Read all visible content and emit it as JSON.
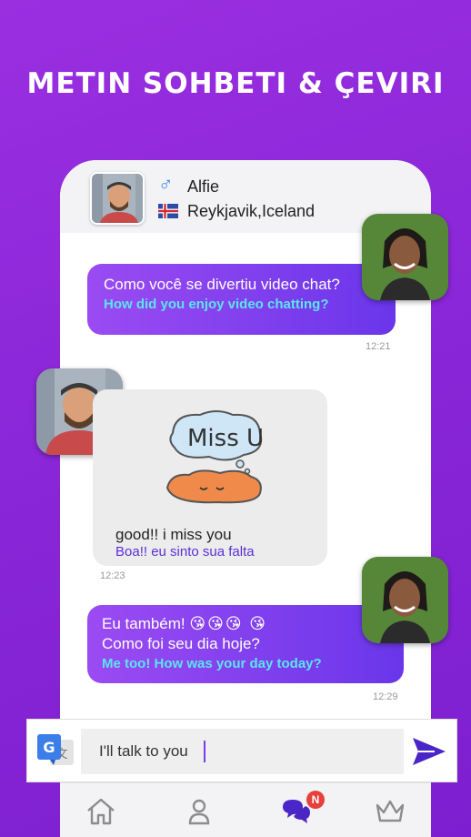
{
  "headline": "METIN SOHBETI & ÇEVIRI",
  "contact": {
    "gender_icon": "male-sign-icon",
    "name": "Alfie",
    "flag_icon": "iceland-flag-icon",
    "location": "Reykjavik,Iceland"
  },
  "messages": [
    {
      "direction": "outgoing",
      "original": "Como você se divertiu video chat?",
      "translation": "How did you enjoy video chatting?",
      "time": "12:21"
    },
    {
      "direction": "incoming",
      "sticker_text": "Miss U",
      "original": "good!! i miss you",
      "translation": "Boa!! eu sinto sua falta",
      "time": "12:23"
    },
    {
      "direction": "outgoing",
      "original_line1": "Eu também!",
      "emojis": "😘😘😘 😘",
      "original_line2": "Como foi seu dia hoje?",
      "translation": "Me too! How was your day today?",
      "time": "12:29"
    }
  ],
  "composer": {
    "translate_icon": "google-translate-icon",
    "input_value": "I'll talk to you",
    "send_icon": "send-icon"
  },
  "tabbar": {
    "items": [
      "home-icon",
      "profile-icon",
      "chat-icon",
      "crown-icon"
    ],
    "badge": "N"
  },
  "colors": {
    "background": "#8a27d8",
    "bubble_start": "#9b4bf2",
    "bubble_end": "#6a36ea",
    "translation_cyan": "#59e6f2",
    "badge_red": "#e8413c"
  }
}
